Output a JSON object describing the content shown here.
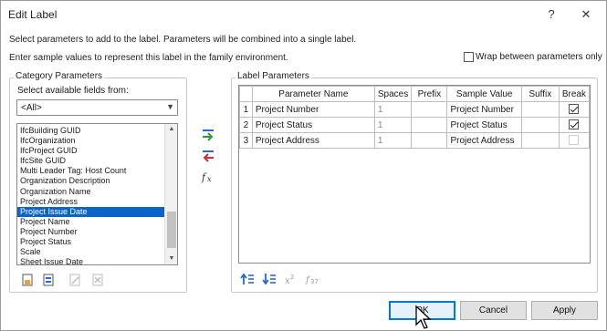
{
  "window": {
    "title": "Edit Label",
    "help_glyph": "?",
    "close_glyph": "✕"
  },
  "info": {
    "line1": "Select parameters to add to the label.  Parameters will be combined into a single label.",
    "line2": "Enter sample values to represent this label in the family environment.",
    "wrap_label": "Wrap between parameters only",
    "wrap_checked": false
  },
  "category": {
    "group_label": "Category Parameters",
    "fields_label": "Select available fields from:",
    "dropdown_value": "<All>",
    "items": [
      "IfcBuilding GUID",
      "IfcOrganization",
      "IfcProject GUID",
      "IfcSite GUID",
      "Multi Leader Tag: Host Count",
      "Organization Description",
      "Organization Name",
      "Project Address",
      "Project Issue Date",
      "Project Name",
      "Project Number",
      "Project Status",
      "Scale",
      "Sheet Issue Date"
    ],
    "selected_item": "Project Issue Date"
  },
  "label_params": {
    "group_label": "Label Parameters",
    "columns": [
      "",
      "Parameter Name",
      "Spaces",
      "Prefix",
      "Sample Value",
      "Suffix",
      "Break"
    ],
    "rows": [
      {
        "index": "1",
        "name": "Project Number",
        "spaces": "1",
        "prefix": "",
        "sample": "Project Number",
        "suffix": "",
        "break": true
      },
      {
        "index": "2",
        "name": "Project Status",
        "spaces": "1",
        "prefix": "",
        "sample": "Project Status",
        "suffix": "",
        "break": true
      },
      {
        "index": "3",
        "name": "Project Address",
        "spaces": "1",
        "prefix": "",
        "sample": "Project Address",
        "suffix": "",
        "break": false
      }
    ]
  },
  "buttons": {
    "ok": "OK",
    "cancel": "Cancel",
    "apply": "Apply"
  },
  "icons": {
    "add_param": "add-parameter-icon",
    "remove_param": "remove-parameter-icon",
    "edit_formula": "fx-icon",
    "move_up": "move-up-icon",
    "move_down": "move-down-icon",
    "edit_units": "units-format-icon",
    "calc_value": "calculated-value-icon",
    "new_param": "new-parameter-icon",
    "edit_param": "edit-parameter-icon",
    "edit_disabled": "edit-disabled-icon",
    "delete_param": "delete-parameter-icon"
  }
}
